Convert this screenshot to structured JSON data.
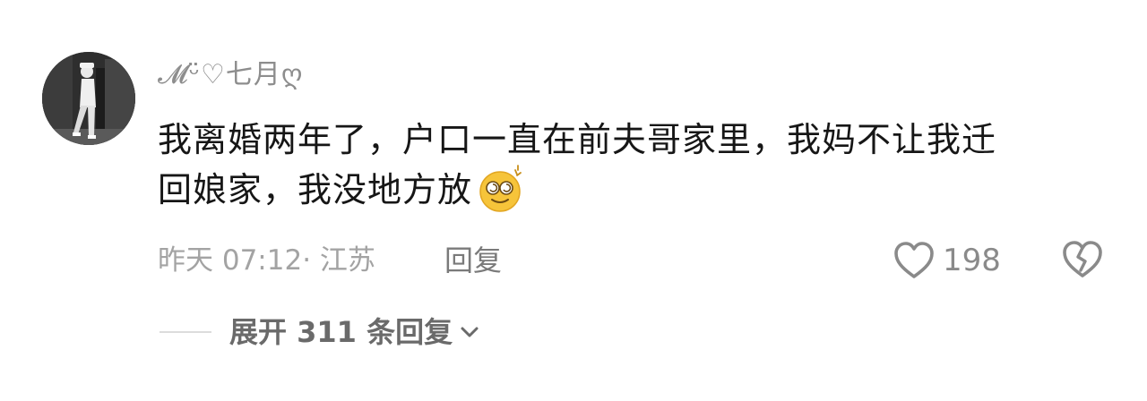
{
  "comment": {
    "username": "𝓜ᵕ̈♡七月ღ",
    "text_lines": [
      "我离婚两年了，户口一直在前夫哥家里，我妈不让我迁",
      "回娘家，我没地方放"
    ],
    "emoji": "dizzy-face-emoji",
    "time": "昨天 07:12",
    "location": "江苏",
    "meta_text": "昨天 07:12· 江苏",
    "reply_label": "回复",
    "like_count": "198",
    "expand_label": "展开 311 条回复"
  },
  "icons": {
    "like": "heart-outline-icon",
    "dislike": "broken-heart-icon",
    "expand": "chevron-down-icon"
  },
  "colors": {
    "text_primary": "#161616",
    "text_secondary": "#a3a3a3",
    "icon_gray": "#8a8a8a",
    "emoji_yellow": "#f6c43a"
  }
}
